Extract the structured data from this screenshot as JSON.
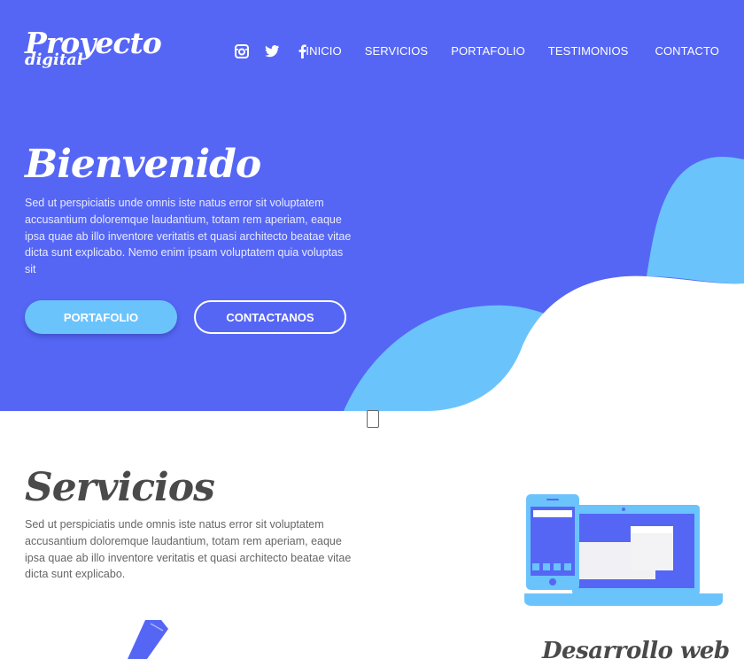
{
  "brand": {
    "logo_line1": "Proyecto",
    "logo_line2": "digital"
  },
  "social": [
    {
      "icon": "instagram-icon"
    },
    {
      "icon": "twitter-icon"
    },
    {
      "icon": "facebook-icon"
    }
  ],
  "nav": {
    "items": [
      "INICIO",
      "SERVICIOS",
      "PORTAFOLIO",
      "TESTIMONIOS",
      "CONTACTO"
    ]
  },
  "hero": {
    "title": "Bienvenido",
    "text": "Sed ut perspiciatis unde omnis iste natus error sit voluptatem accusantium doloremque laudantium, totam rem aperiam, eaque ipsa quae ab illo inventore veritatis et quasi architecto beatae vitae dicta sunt explicabo. Nemo enim ipsam voluptatem quia voluptas sit",
    "button_primary": "PORTAFOLIO",
    "button_secondary": "CONTACTANOS"
  },
  "services": {
    "title": "Servicios",
    "text": "Sed ut perspiciatis unde omnis iste natus error sit voluptatem accusantium doloremque laudantium, totam rem aperiam, eaque ipsa quae ab illo inventore veritatis et quasi architecto beatae vitae dicta sunt explicabo.",
    "subtitle": "Desarrollo web"
  },
  "colors": {
    "primary": "#5566F5",
    "accent": "#6BC3FC",
    "text_dark": "#4A4A4A"
  }
}
